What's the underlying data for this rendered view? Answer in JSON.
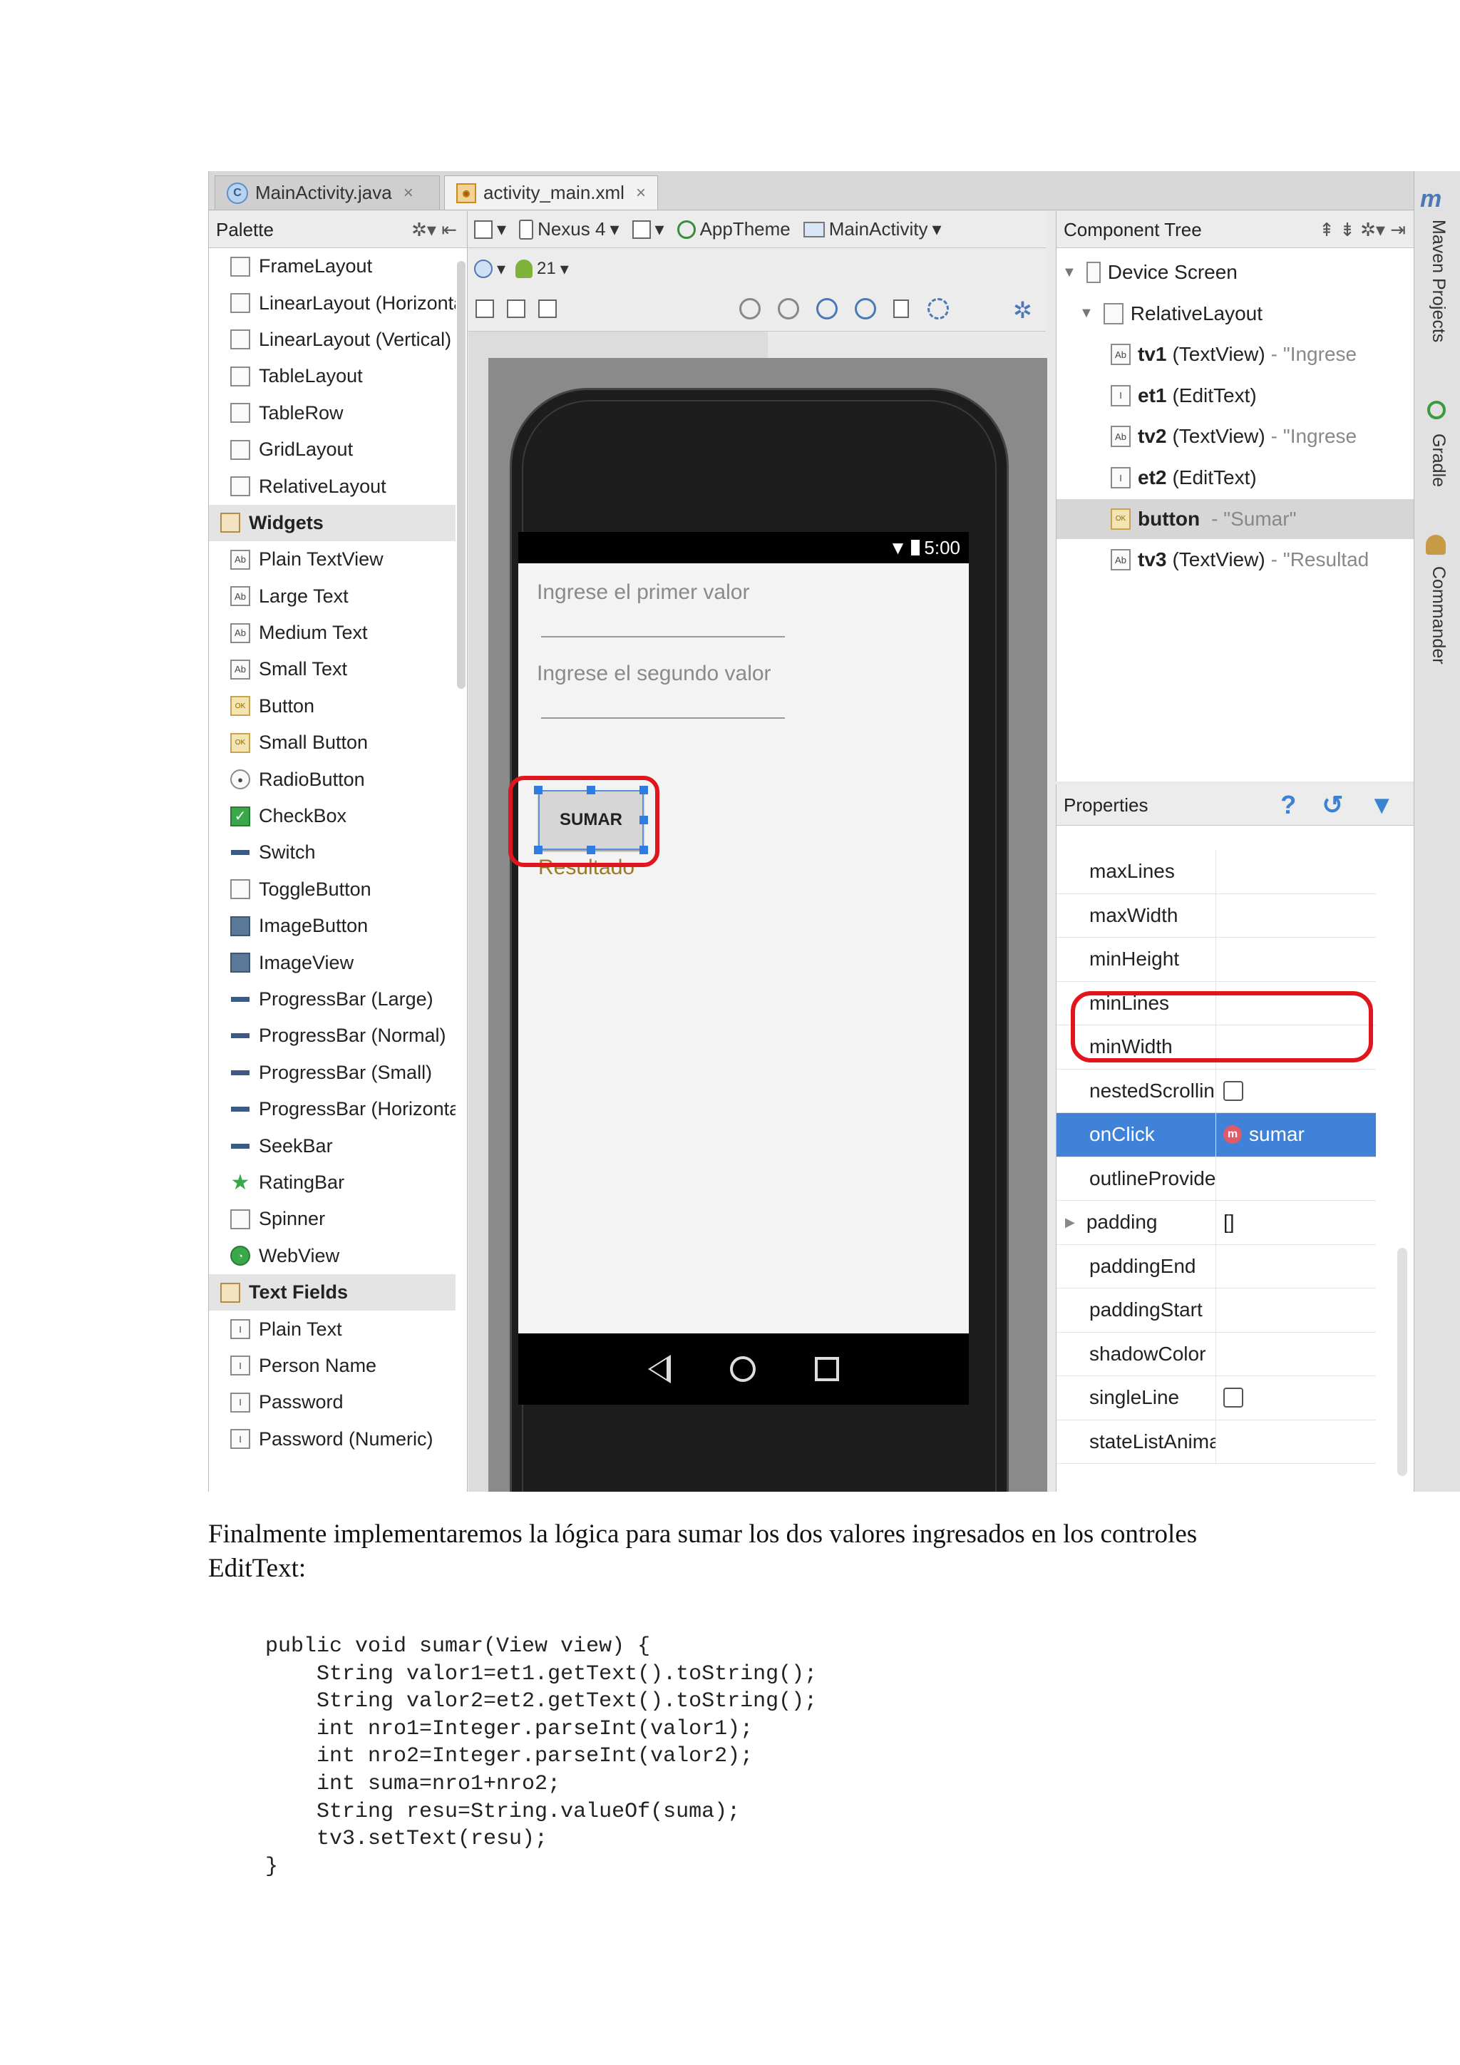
{
  "tabs": [
    {
      "label": "MainActivity.java",
      "icon": "java-class-icon"
    },
    {
      "label": "activity_main.xml",
      "icon": "xml-layout-icon"
    }
  ],
  "tab_close": "×",
  "palette": {
    "title": "Palette",
    "items": [
      {
        "label": "FrameLayout",
        "group": false
      },
      {
        "label": "LinearLayout (Horizontal)",
        "group": false
      },
      {
        "label": "LinearLayout (Vertical)",
        "group": false
      },
      {
        "label": "TableLayout",
        "group": false
      },
      {
        "label": "TableRow",
        "group": false
      },
      {
        "label": "GridLayout",
        "group": false
      },
      {
        "label": "RelativeLayout",
        "group": false
      },
      {
        "label": "Widgets",
        "group": true
      },
      {
        "label": "Plain TextView",
        "group": false
      },
      {
        "label": "Large Text",
        "group": false
      },
      {
        "label": "Medium Text",
        "group": false
      },
      {
        "label": "Small Text",
        "group": false
      },
      {
        "label": "Button",
        "group": false
      },
      {
        "label": "Small Button",
        "group": false
      },
      {
        "label": "RadioButton",
        "group": false
      },
      {
        "label": "CheckBox",
        "group": false
      },
      {
        "label": "Switch",
        "group": false
      },
      {
        "label": "ToggleButton",
        "group": false
      },
      {
        "label": "ImageButton",
        "group": false
      },
      {
        "label": "ImageView",
        "group": false
      },
      {
        "label": "ProgressBar (Large)",
        "group": false
      },
      {
        "label": "ProgressBar (Normal)",
        "group": false
      },
      {
        "label": "ProgressBar (Small)",
        "group": false
      },
      {
        "label": "ProgressBar (Horizontal)",
        "group": false
      },
      {
        "label": "SeekBar",
        "group": false
      },
      {
        "label": "RatingBar",
        "group": false
      },
      {
        "label": "Spinner",
        "group": false
      },
      {
        "label": "WebView",
        "group": false
      },
      {
        "label": "Text Fields",
        "group": true
      },
      {
        "label": "Plain Text",
        "group": false
      },
      {
        "label": "Person Name",
        "group": false
      },
      {
        "label": "Password",
        "group": false
      },
      {
        "label": "Password (Numeric)",
        "group": false
      }
    ]
  },
  "toolbar": {
    "device": "Nexus 4",
    "api": "21",
    "theme": "AppTheme",
    "activity": "MainActivity"
  },
  "phone": {
    "time": "5:00",
    "hint1": "Ingrese el primer valor",
    "hint2": "Ingrese el segundo valor",
    "button": "SUMAR",
    "result": "Resultado"
  },
  "component_tree": {
    "title": "Component Tree",
    "rows": [
      {
        "id": "",
        "type": "Device Screen",
        "extra": ""
      },
      {
        "id": "",
        "type": "RelativeLayout",
        "extra": ""
      },
      {
        "id": "tv1",
        "type": "(TextView)",
        "extra": "- \"Ingrese"
      },
      {
        "id": "et1",
        "type": "(EditText)",
        "extra": ""
      },
      {
        "id": "tv2",
        "type": "(TextView)",
        "extra": "- \"Ingrese"
      },
      {
        "id": "et2",
        "type": "(EditText)",
        "extra": ""
      },
      {
        "id": "button",
        "type": "",
        "extra": "- \"Sumar\""
      },
      {
        "id": "tv3",
        "type": "(TextView)",
        "extra": "- \"Resultad"
      }
    ]
  },
  "properties": {
    "title": "Properties",
    "rows": [
      {
        "name": "maxLines",
        "value": ""
      },
      {
        "name": "maxWidth",
        "value": ""
      },
      {
        "name": "minHeight",
        "value": ""
      },
      {
        "name": "minLines",
        "value": ""
      },
      {
        "name": "minWidth",
        "value": ""
      },
      {
        "name": "nestedScrolling",
        "value": ""
      },
      {
        "name": "onClick",
        "value": "sumar"
      },
      {
        "name": "outlineProvider",
        "value": ""
      },
      {
        "name": "padding",
        "value": "[]"
      },
      {
        "name": "paddingEnd",
        "value": ""
      },
      {
        "name": "paddingStart",
        "value": ""
      },
      {
        "name": "shadowColor",
        "value": ""
      },
      {
        "name": "singleLine",
        "value": ""
      },
      {
        "name": "stateListAnimator",
        "value": ""
      }
    ]
  },
  "side_tabs": [
    "Maven Projects",
    "Gradle",
    "Commander"
  ],
  "document": {
    "paragraph": "Finalmente implementaremos la lógica para sumar los dos valores ingresados en los controles EditText:",
    "code": [
      "public void sumar(View view) {",
      "    String valor1=et1.getText().toString();",
      "    String valor2=et2.getText().toString();",
      "    int nro1=Integer.parseInt(valor1);",
      "    int nro2=Integer.parseInt(valor2);",
      "    int suma=nro1+nro2;",
      "    String resu=String.valueOf(suma);",
      "    tv3.setText(resu);",
      "}"
    ]
  },
  "colors": {
    "highlight": "#e0161c",
    "selection": "#3f82d8"
  }
}
